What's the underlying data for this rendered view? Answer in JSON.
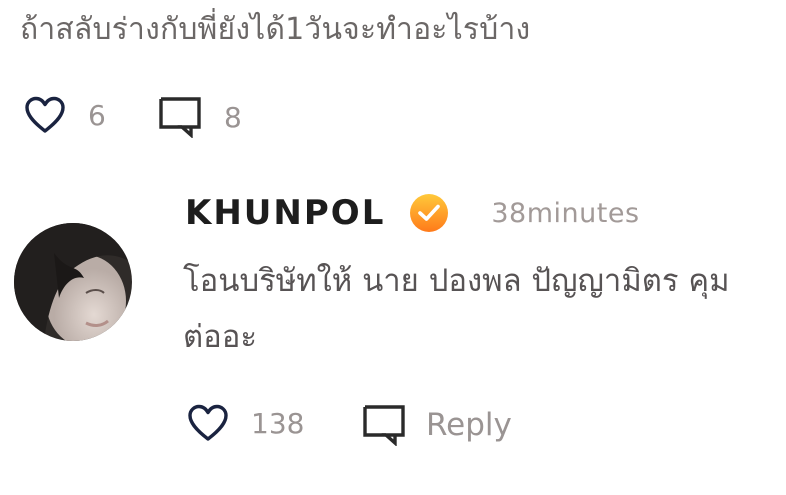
{
  "post": {
    "text": "ถ้าสลับร่างกับพี่ยังได้1วันจะทำอะไรบ้าง",
    "like_count": "6",
    "comment_count": "8"
  },
  "comment": {
    "author": "KHUNPOL",
    "timestamp": "38minutes",
    "text": "โอนบริษัทให้ นาย ปองพล ปัญญามิตร คุมต่ออะ",
    "like_count": "138",
    "reply_label": "Reply"
  },
  "colors": {
    "icon_dark": "#1a2340",
    "badge_gradient_top": "#ffc93a",
    "badge_gradient_bottom": "#ff7a1a"
  },
  "icons": [
    "heart-outline-icon",
    "comment-bubble-icon",
    "verified-badge-icon"
  ]
}
